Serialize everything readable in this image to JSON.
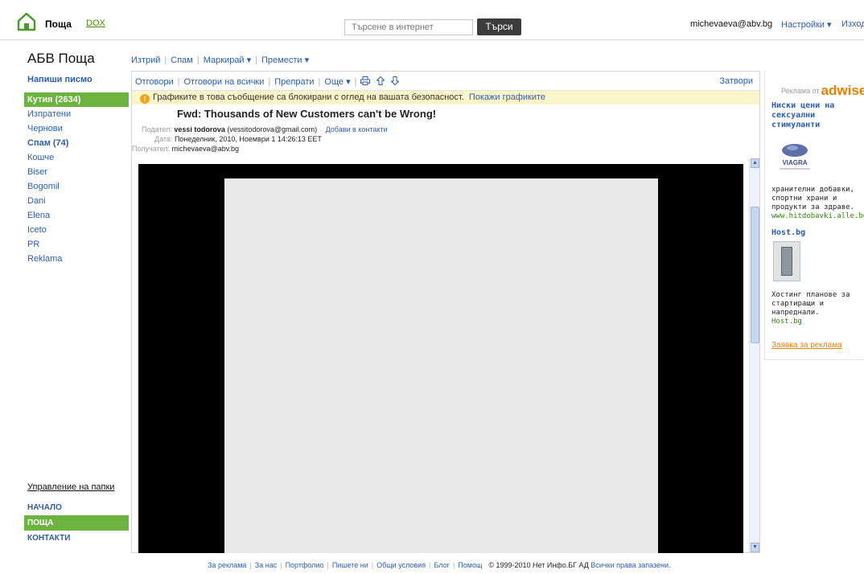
{
  "header": {
    "app_name": "Поща",
    "dox_link": "DOX",
    "search_placeholder": "Търсене в интернет",
    "search_button": "Търси",
    "user_email": "michevaeva@abv.bg",
    "settings_label": "Настройки ▾",
    "logout_label": "Изход"
  },
  "sidebar": {
    "title": "АБВ Поща",
    "compose_label": "Напиши писмо",
    "folders": [
      {
        "label": "Кутия (2634)"
      },
      {
        "label": "Изпратени"
      },
      {
        "label": "Чернови"
      },
      {
        "label": "Спам (74)"
      },
      {
        "label": "Кошче"
      },
      {
        "label": "Biser"
      },
      {
        "label": "Bogomil"
      },
      {
        "label": "Dani"
      },
      {
        "label": "Elena"
      },
      {
        "label": "Iceto"
      },
      {
        "label": "PR"
      },
      {
        "label": "Reklama"
      }
    ],
    "manage_folders": "Управление на папки",
    "nav": [
      {
        "label": "НАЧАЛО"
      },
      {
        "label": "ПОЩА"
      },
      {
        "label": "КОНТАКТИ"
      }
    ]
  },
  "actions": {
    "delete": "Изтрий",
    "spam": "Спам",
    "mark": "Маркирай ▾",
    "move": "Премести ▾"
  },
  "message_toolbar": {
    "reply": "Отговори",
    "reply_all": "Отговори на всички",
    "forward": "Препрати",
    "more": "Още ▾",
    "close": "Затвори"
  },
  "warning": {
    "text": "Графиките в това съобщение са блокирани с оглед на вашата безопасност.",
    "link": "Покажи графиките"
  },
  "message": {
    "subject": "Fwd: Thousands of New Customers can't be Wrong!",
    "from_label": "Подател:",
    "from_name": "vessi todorova",
    "from_email": "(vessitodorova@gmail.com)",
    "add_contact": "Добави в контакти",
    "date_label": "Дата:",
    "date_value": "Понеделник, 2010, Ноември 1 14:26:13 EET",
    "to_label": "Получател:",
    "to_value": "michevaeva@abv.bg"
  },
  "ads": {
    "by_label": "Реклама от",
    "by_logo": "adwise",
    "ad1_title": "Ниски цени на сексуални стимуланти",
    "ad1_brand": "VIAGRA",
    "ad1_text": "хранителни добавки, спортни храни и продукти за здраве.",
    "ad1_url": "www.hitdobavki.alle.bg",
    "ad2_title": "Host.bg",
    "ad2_text": "Хостинг планове за стартиращи и напреднали.",
    "ad2_url": "Host.bg",
    "order_link": "Заявка за реклама"
  },
  "footer": {
    "links": [
      "За реклама",
      "За нас",
      "Портфолио",
      "Пишете ни",
      "Общи условия",
      "Блог",
      "Помощ"
    ],
    "copyright": "© 1999-2010 Нет Инфо.БГ АД",
    "rights": "Всички права запазени."
  },
  "colors": {
    "accent_green": "#6cb33f",
    "link_blue": "#2a5db0",
    "warning_bg": "#fbf6c9",
    "ad_orange": "#ef7d00"
  }
}
